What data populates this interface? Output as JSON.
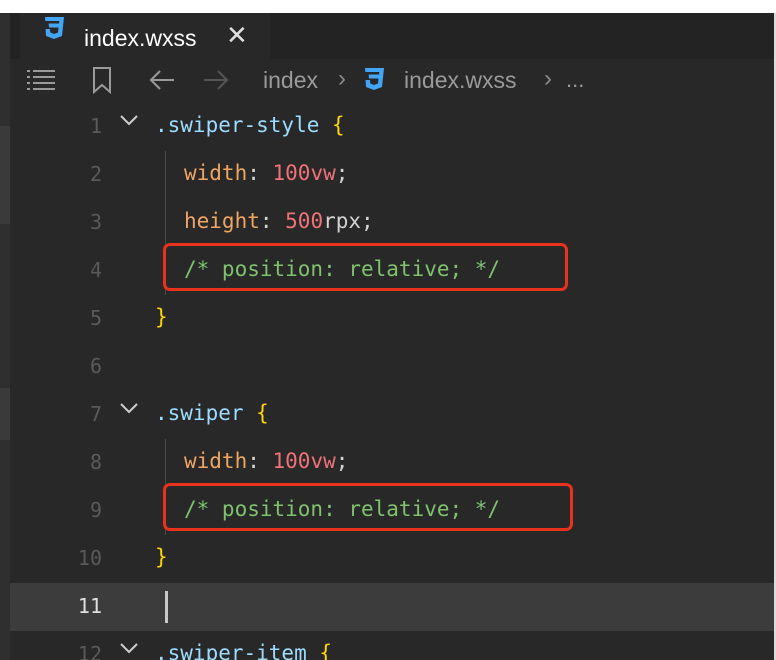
{
  "colors": {
    "selector": "#9cdcfe",
    "brace": "#ffd700",
    "property": "#f0a563",
    "number": "#f07178",
    "unit": "#f07178",
    "comment": "#7fc26e",
    "punct": "#d4d4d4",
    "line_number": "#5a5a5a",
    "current_line_number": "#e0e0e0",
    "highlight_box": "#e8321e",
    "css_icon": "#42a5f5"
  },
  "tab": {
    "icon": "css3-file-icon",
    "label": "index.wxss",
    "close": "✕"
  },
  "toolbar": {
    "outline_icon": "list-icon",
    "bookmark_icon": "bookmark-icon",
    "back_icon": "arrow-left-icon",
    "forward_icon": "arrow-right-icon"
  },
  "breadcrumb": {
    "folder": "index",
    "file": "index.wxss",
    "separator": "›",
    "ellipsis": "..."
  },
  "editor": {
    "current_line": 11,
    "lines": [
      {
        "num": "1",
        "fold": true,
        "tokens": [
          {
            "text": ".swiper-style",
            "kind": "selector"
          },
          {
            "text": " ",
            "kind": "punct"
          },
          {
            "text": "{",
            "kind": "brace"
          }
        ]
      },
      {
        "num": "2",
        "tokens": [
          {
            "text": "width",
            "kind": "property"
          },
          {
            "text": ": ",
            "kind": "punct"
          },
          {
            "text": "100vw",
            "kind": "number"
          },
          {
            "text": ";",
            "kind": "punct"
          }
        ]
      },
      {
        "num": "3",
        "tokens": [
          {
            "text": "height",
            "kind": "property"
          },
          {
            "text": ": ",
            "kind": "punct"
          },
          {
            "text": "500",
            "kind": "number"
          },
          {
            "text": "rpx",
            "kind": "punct"
          },
          {
            "text": ";",
            "kind": "punct"
          }
        ]
      },
      {
        "num": "4",
        "highlight": true,
        "tokens": [
          {
            "text": "/* position: relative; */",
            "kind": "comment"
          }
        ]
      },
      {
        "num": "5",
        "tokens": [
          {
            "text": "}",
            "kind": "brace"
          }
        ]
      },
      {
        "num": "6",
        "tokens": []
      },
      {
        "num": "7",
        "fold": true,
        "tokens": [
          {
            "text": ".swiper",
            "kind": "selector"
          },
          {
            "text": " ",
            "kind": "punct"
          },
          {
            "text": "{",
            "kind": "brace"
          }
        ]
      },
      {
        "num": "8",
        "tokens": [
          {
            "text": "width",
            "kind": "property"
          },
          {
            "text": ": ",
            "kind": "punct"
          },
          {
            "text": "100vw",
            "kind": "number"
          },
          {
            "text": ";",
            "kind": "punct"
          }
        ]
      },
      {
        "num": "9",
        "highlight": true,
        "tokens": [
          {
            "text": "/* position: relative; */",
            "kind": "comment"
          }
        ]
      },
      {
        "num": "10",
        "tokens": [
          {
            "text": "}",
            "kind": "brace"
          }
        ]
      },
      {
        "num": "11",
        "tokens": []
      },
      {
        "num": "12",
        "fold": true,
        "tokens": [
          {
            "text": ".swiper-item",
            "kind": "selector"
          },
          {
            "text": " ",
            "kind": "punct"
          },
          {
            "text": "{",
            "kind": "brace"
          }
        ]
      }
    ]
  }
}
